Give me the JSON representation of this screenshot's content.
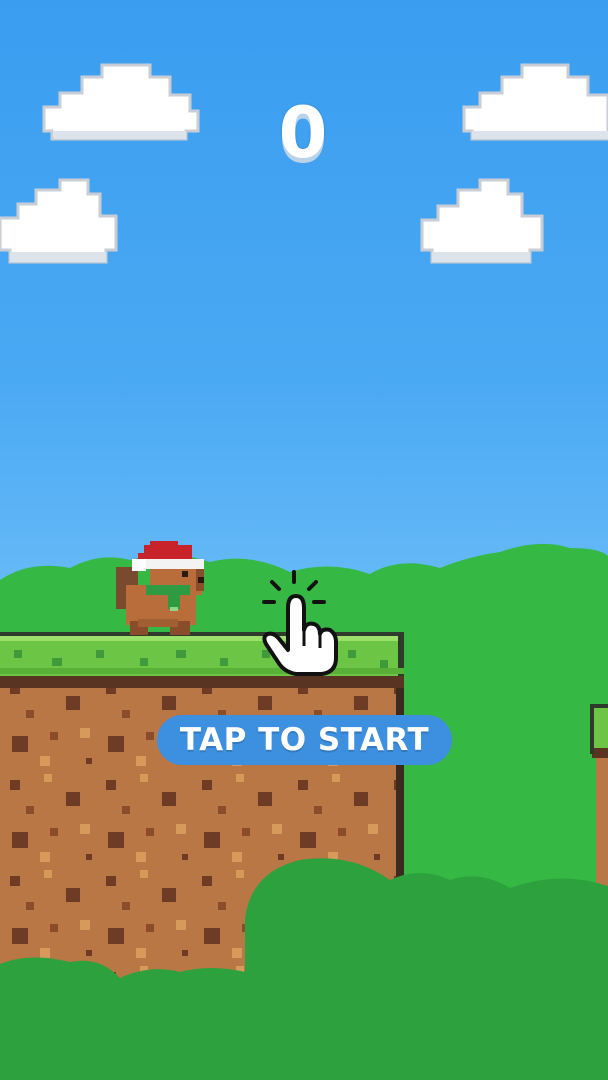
{
  "hud": {
    "score": "0"
  },
  "prompt": {
    "label": "TAP TO START"
  },
  "character": {
    "name": "dog-with-santa-hat"
  },
  "icons": {
    "hint": "tap-hand-icon"
  },
  "colors": {
    "sky_top": "#3a9df0",
    "sky_bottom": "#a3dafd",
    "bush_light": "#36b845",
    "bush_dark": "#2ea13f",
    "grass": "#6cc544",
    "dirt": "#b87744",
    "button": "#3d8fe0"
  }
}
